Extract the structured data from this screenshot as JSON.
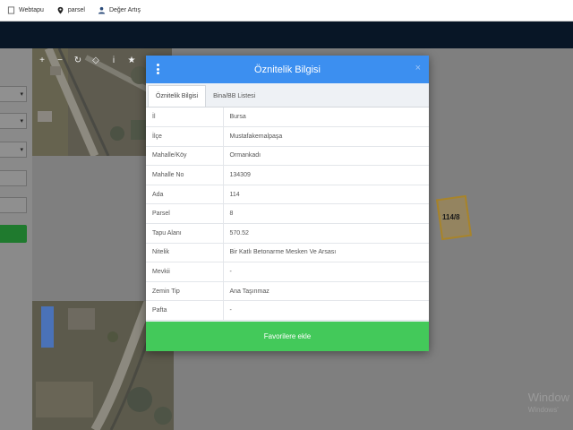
{
  "bookmarks": [
    {
      "label": "Webtapu",
      "icon": "page-icon"
    },
    {
      "label": "parsel",
      "icon": "map-pin-icon"
    },
    {
      "label": "Değer Artış",
      "icon": "person-icon"
    }
  ],
  "map_tools": [
    {
      "glyph": "+",
      "name": "zoom-in-icon"
    },
    {
      "glyph": "−",
      "name": "zoom-out-icon"
    },
    {
      "glyph": "↻",
      "name": "refresh-icon"
    },
    {
      "glyph": "◇",
      "name": "locate-icon"
    },
    {
      "glyph": "i",
      "name": "info-icon"
    },
    {
      "glyph": "★",
      "name": "star-icon"
    }
  ],
  "parcel_label": "114/8",
  "windows_watermark": {
    "line1": "Window",
    "line2": "Windows'"
  },
  "modal": {
    "title": "Öznitelik Bilgisi",
    "close": "×",
    "tabs": [
      {
        "label": "Öznitelik Bilgisi",
        "active": true
      },
      {
        "label": "Bina/BB Listesi",
        "active": false
      }
    ],
    "rows": [
      {
        "key": "İl",
        "value": "Bursa"
      },
      {
        "key": "İlçe",
        "value": "Mustafakemalpaşa"
      },
      {
        "key": "Mahalle/Köy",
        "value": "Ormankadı"
      },
      {
        "key": "Mahalle No",
        "value": "134309"
      },
      {
        "key": "Ada",
        "value": "114"
      },
      {
        "key": "Parsel",
        "value": "8"
      },
      {
        "key": "Tapu Alanı",
        "value": "570.52"
      },
      {
        "key": "Nitelik",
        "value": "Bir Katlı Betonarme Mesken Ve Arsası"
      },
      {
        "key": "Mevkii",
        "value": "-"
      },
      {
        "key": "Zemin Tip",
        "value": "Ana Taşınmaz"
      },
      {
        "key": "Pafta",
        "value": "-"
      }
    ],
    "favorite_button": "Favorilere ekle"
  },
  "colors": {
    "header_blue": "#3c8ff0",
    "favorite_green": "#43c95a",
    "topbar": "#081626"
  }
}
